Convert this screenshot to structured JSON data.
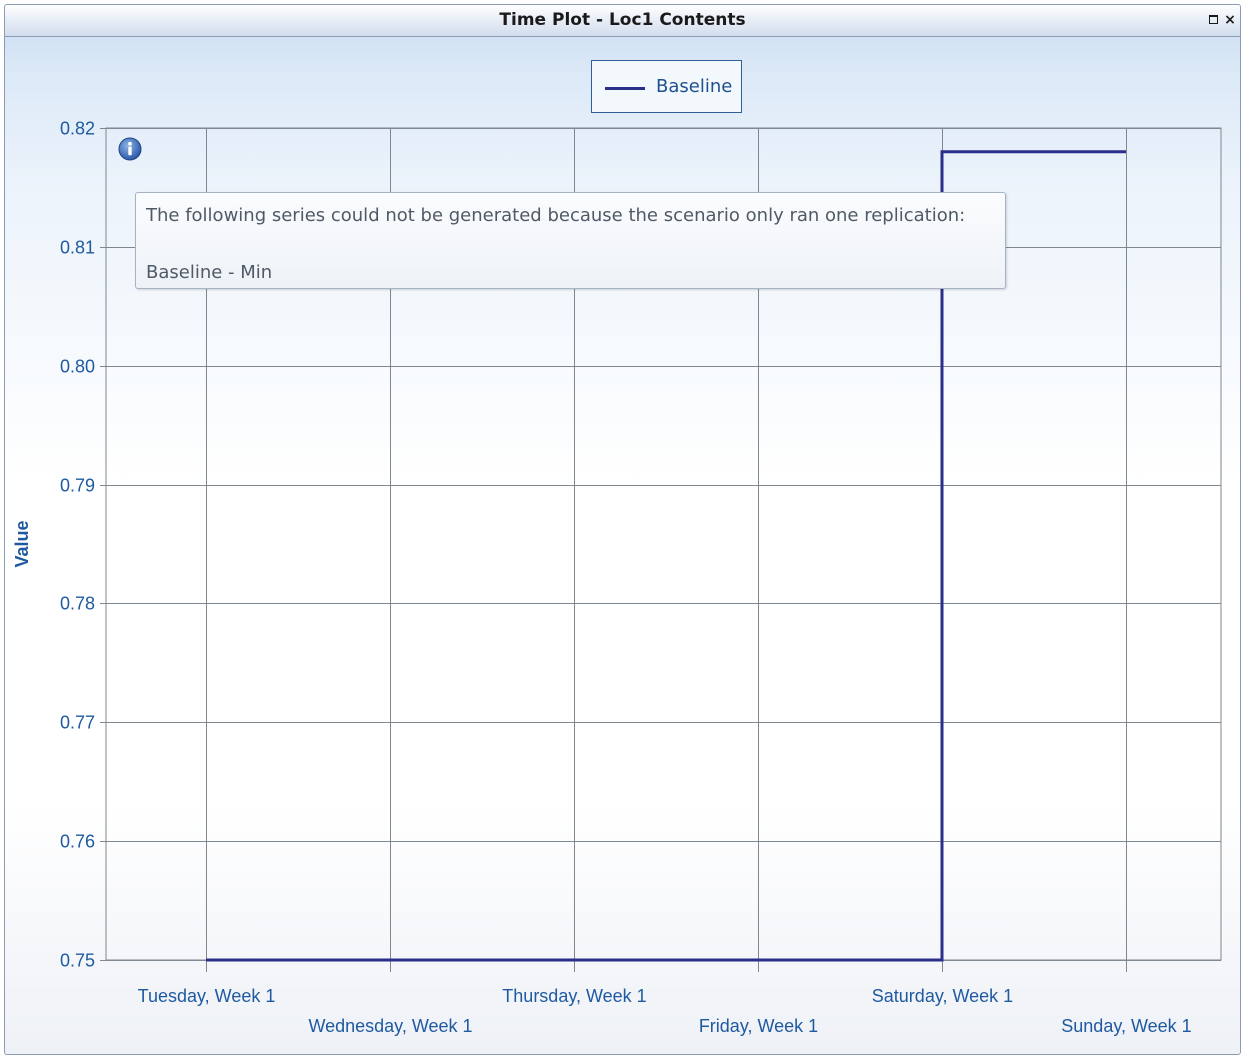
{
  "window": {
    "title": "Time Plot - Loc1 Contents",
    "maximize_icon": "maximize-icon",
    "close_icon": "close-icon",
    "close_label": "×"
  },
  "legend": {
    "items": [
      {
        "label": "Baseline",
        "color": "#2b2f8c"
      }
    ]
  },
  "info_tooltip": {
    "icon": "info-icon",
    "line1": "The following series could not be generated because the scenario only ran one replication:",
    "line2": "Baseline - Min"
  },
  "chart_data": {
    "type": "line",
    "step": true,
    "title": "",
    "xlabel": "",
    "ylabel": "Value",
    "ylim": [
      0.75,
      0.82
    ],
    "yticks": [
      "0.82",
      "0.81",
      "0.80",
      "0.79",
      "0.78",
      "0.77",
      "0.76",
      "0.75"
    ],
    "x_tick_labels": [
      "Tuesday, Week 1",
      "Wednesday, Week 1",
      "Thursday, Week 1",
      "Friday, Week 1",
      "Saturday, Week 1",
      "Sunday, Week 1"
    ],
    "grid": true,
    "legend_position": "top-center",
    "series": [
      {
        "name": "Baseline",
        "color": "#2b2f8c",
        "points": [
          {
            "x": "Tuesday, Week 1",
            "y": 0.75
          },
          {
            "x": "Saturday, Week 1",
            "y": 0.75
          },
          {
            "x": "Saturday, Week 1",
            "y": 0.818
          },
          {
            "x": "Sunday, Week 1",
            "y": 0.818
          }
        ]
      }
    ]
  }
}
